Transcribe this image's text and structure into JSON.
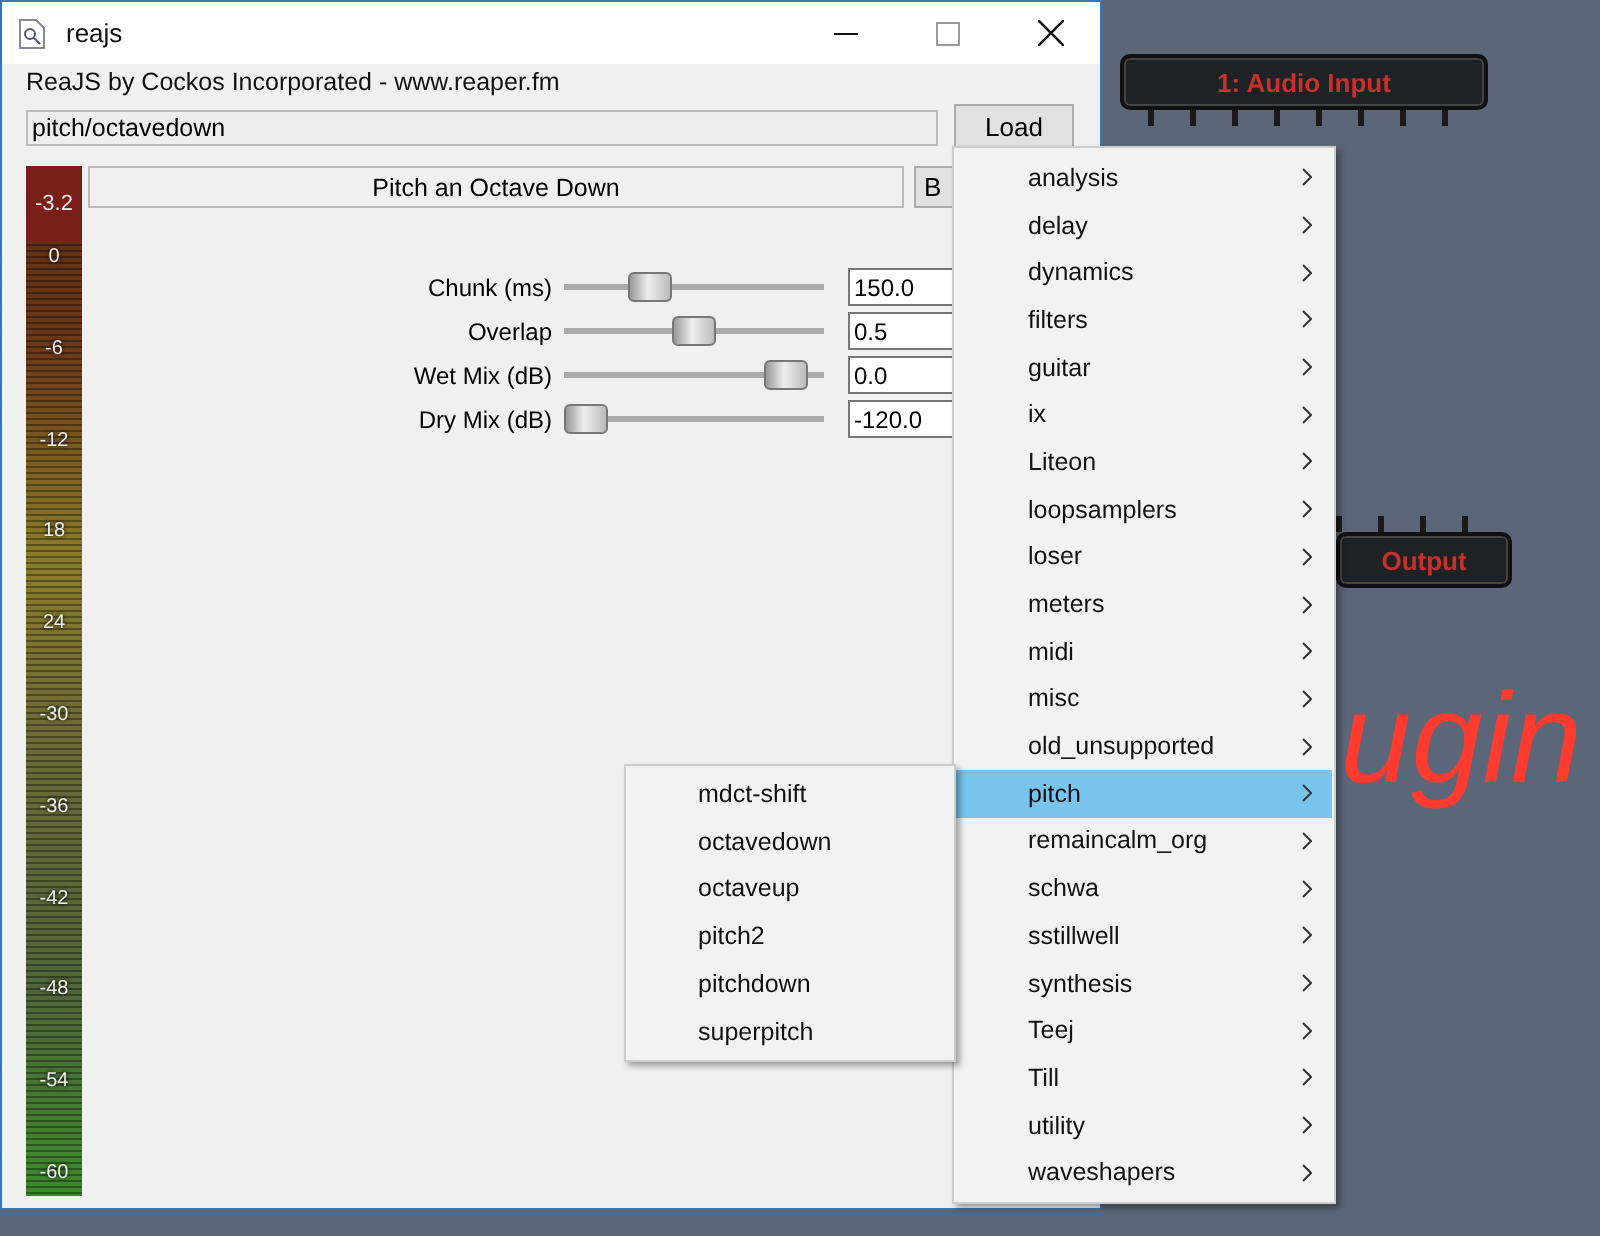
{
  "window": {
    "title": "reajs"
  },
  "header": "ReaJS by Cockos Incorporated - www.reaper.fm",
  "path_field": {
    "value": "pitch/octavedown"
  },
  "load_button": "Load",
  "meter": {
    "peak": "-3.2",
    "scale": [
      "0",
      "-6",
      "-12",
      "18",
      "24",
      "-30",
      "-36",
      "-42",
      "-48",
      "-54",
      "-60"
    ]
  },
  "description": "Pitch an Octave Down",
  "side_button": "B",
  "sliders": [
    {
      "label": "Chunk (ms)",
      "level": 0.3,
      "value": "150.0"
    },
    {
      "label": "Overlap",
      "level": 0.5,
      "value": "0.5"
    },
    {
      "label": "Wet Mix (dB)",
      "level": 0.93,
      "value": "0.0"
    },
    {
      "label": "Dry Mix (dB)",
      "level": 0.0,
      "value": "-120.0"
    }
  ],
  "canvas": {
    "nodes": [
      {
        "label": "1: Audio Input"
      },
      {
        "label": "Output"
      }
    ],
    "background_text": "ugin"
  },
  "menu": {
    "items": [
      {
        "label": "analysis",
        "selected": false
      },
      {
        "label": "delay",
        "selected": false
      },
      {
        "label": "dynamics",
        "selected": false
      },
      {
        "label": "filters",
        "selected": false
      },
      {
        "label": "guitar",
        "selected": false
      },
      {
        "label": "ix",
        "selected": false
      },
      {
        "label": "Liteon",
        "selected": false
      },
      {
        "label": "loopsamplers",
        "selected": false
      },
      {
        "label": "loser",
        "selected": false
      },
      {
        "label": "meters",
        "selected": false
      },
      {
        "label": "midi",
        "selected": false
      },
      {
        "label": "misc",
        "selected": false
      },
      {
        "label": "old_unsupported",
        "selected": false
      },
      {
        "label": "pitch",
        "selected": true
      },
      {
        "label": "remaincalm_org",
        "selected": false
      },
      {
        "label": "schwa",
        "selected": false
      },
      {
        "label": "sstillwell",
        "selected": false
      },
      {
        "label": "synthesis",
        "selected": false
      },
      {
        "label": "Teej",
        "selected": false
      },
      {
        "label": "Till",
        "selected": false
      },
      {
        "label": "utility",
        "selected": false
      },
      {
        "label": "waveshapers",
        "selected": false
      }
    ],
    "submenu": [
      "mdct-shift",
      "octavedown",
      "octaveup",
      "pitch2",
      "pitchdown",
      "superpitch"
    ]
  }
}
